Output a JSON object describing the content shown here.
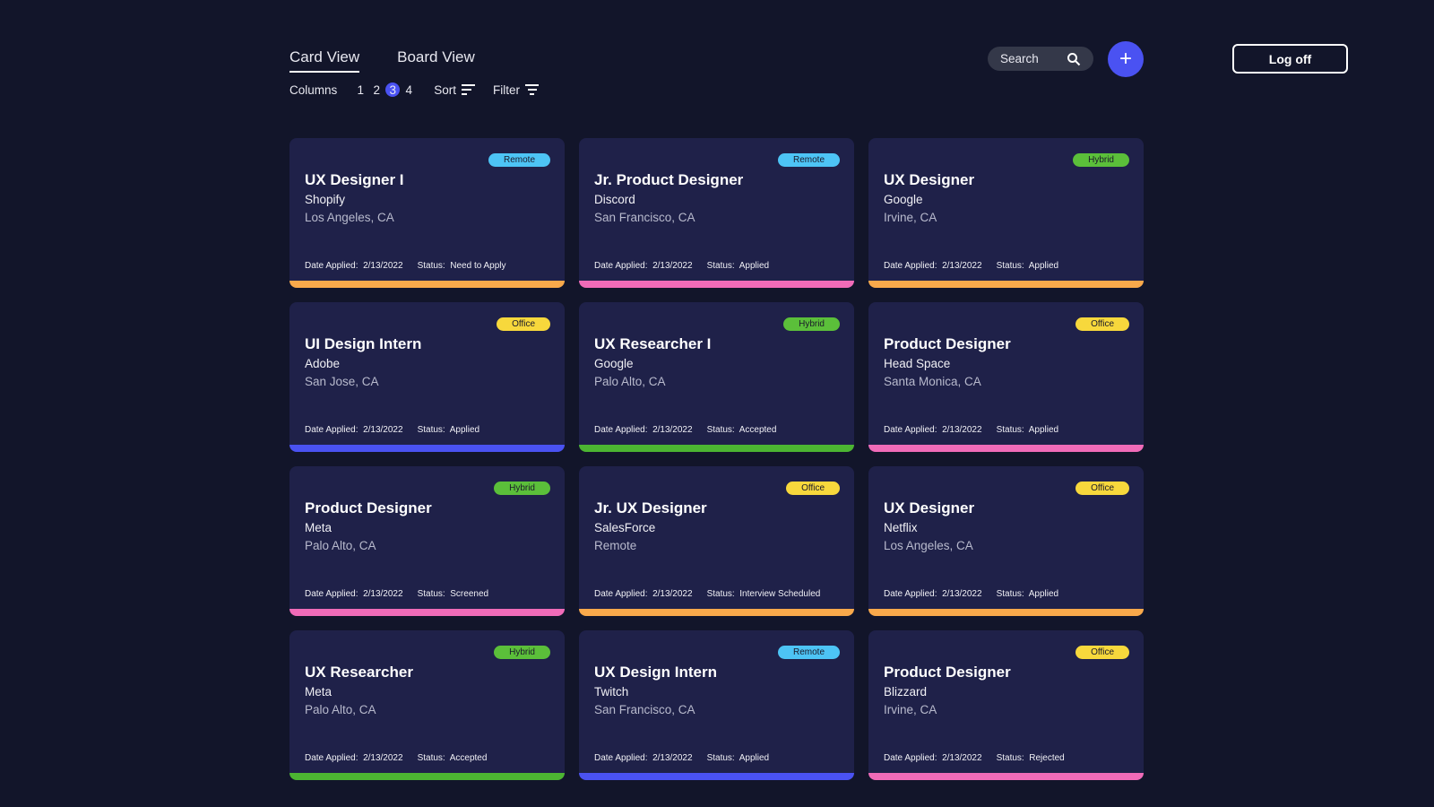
{
  "tabs": [
    {
      "label": "Card View",
      "active": true
    },
    {
      "label": "Board View",
      "active": false
    }
  ],
  "controls": {
    "columns_label": "Columns",
    "columns": [
      "1",
      "2",
      "3",
      "4"
    ],
    "sort_label": "Sort",
    "filter_label": "Filter"
  },
  "search": {
    "placeholder": "Search"
  },
  "add_label": "+",
  "logoff_label": "Log off",
  "labels": {
    "date": "Date Applied:",
    "status": "Status:"
  },
  "colors": {
    "Remote": "#4dc4f5",
    "Hybrid": "#5bbf3a",
    "Office": "#f7d83c",
    "orange": "#f9a94b",
    "pink": "#f06bb8",
    "blue": "#4a52f2",
    "green": "#4cb532"
  },
  "cards": [
    {
      "title": "UX Designer I",
      "company": "Shopify",
      "location": "Los Angeles, CA",
      "type": "Remote",
      "date": "2/13/2022",
      "status": "Need to Apply",
      "bar": "orange"
    },
    {
      "title": "Jr. Product Designer",
      "company": "Discord",
      "location": "San Francisco, CA",
      "type": "Remote",
      "date": "2/13/2022",
      "status": "Applied",
      "bar": "pink"
    },
    {
      "title": "UX Designer",
      "company": "Google",
      "location": "Irvine, CA",
      "type": "Hybrid",
      "date": "2/13/2022",
      "status": "Applied",
      "bar": "orange"
    },
    {
      "title": "UI Design Intern",
      "company": "Adobe",
      "location": "San Jose, CA",
      "type": "Office",
      "date": "2/13/2022",
      "status": "Applied",
      "bar": "blue"
    },
    {
      "title": "UX Researcher I",
      "company": "Google",
      "location": "Palo Alto, CA",
      "type": "Hybrid",
      "date": "2/13/2022",
      "status": "Accepted",
      "bar": "green"
    },
    {
      "title": "Product Designer",
      "company": "Head Space",
      "location": "Santa Monica, CA",
      "type": "Office",
      "date": "2/13/2022",
      "status": "Applied",
      "bar": "pink"
    },
    {
      "title": "Product Designer",
      "company": "Meta",
      "location": "Palo Alto, CA",
      "type": "Hybrid",
      "date": "2/13/2022",
      "status": "Screened",
      "bar": "pink"
    },
    {
      "title": "Jr. UX Designer",
      "company": "SalesForce",
      "location": "Remote",
      "type": "Office",
      "date": "2/13/2022",
      "status": "Interview Scheduled",
      "bar": "orange"
    },
    {
      "title": "UX Designer",
      "company": "Netflix",
      "location": "Los Angeles, CA",
      "type": "Office",
      "date": "2/13/2022",
      "status": "Applied",
      "bar": "orange"
    },
    {
      "title": "UX Researcher",
      "company": "Meta",
      "location": "Palo Alto, CA",
      "type": "Hybrid",
      "date": "2/13/2022",
      "status": "Accepted",
      "bar": "green"
    },
    {
      "title": "UX Design Intern",
      "company": "Twitch",
      "location": "San Francisco, CA",
      "type": "Remote",
      "date": "2/13/2022",
      "status": "Applied",
      "bar": "blue"
    },
    {
      "title": "Product Designer",
      "company": "Blizzard",
      "location": "Irvine, CA",
      "type": "Office",
      "date": "2/13/2022",
      "status": "Rejected",
      "bar": "pink"
    }
  ]
}
